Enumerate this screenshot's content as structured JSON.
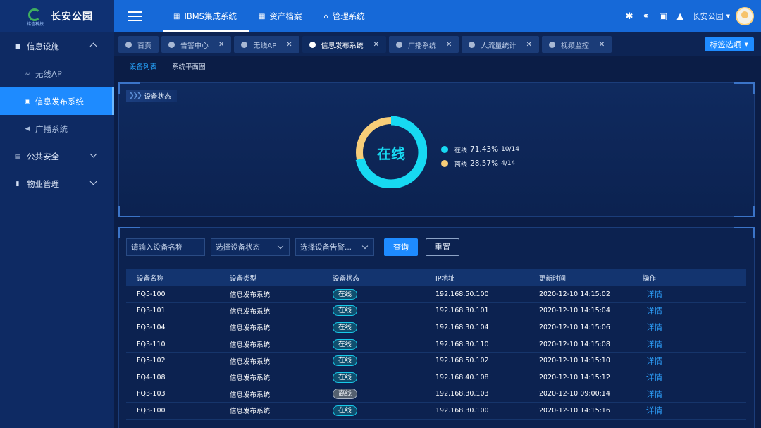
{
  "sidebar": {
    "logo_text": "长安公园",
    "logo_small": "铭信科技",
    "groups": [
      {
        "label": "信息设施",
        "icon": "chat-icon",
        "expanded": true,
        "items": [
          {
            "label": "无线AP",
            "icon": "wifi-icon",
            "active": false
          },
          {
            "label": "信息发布系统",
            "icon": "bus-icon",
            "active": true
          },
          {
            "label": "广播系统",
            "icon": "speaker-icon",
            "active": false
          }
        ]
      },
      {
        "label": "公共安全",
        "icon": "bed-icon",
        "expanded": false
      },
      {
        "label": "物业管理",
        "icon": "map-icon",
        "expanded": false
      }
    ]
  },
  "topbar": {
    "menus": [
      {
        "label": "IBMS集成系统",
        "icon": "grid-icon",
        "active": true
      },
      {
        "label": "资产档案",
        "icon": "grid-icon",
        "active": false
      },
      {
        "label": "管理系统",
        "icon": "home-icon",
        "active": false
      }
    ],
    "user": "长安公园",
    "icons": [
      "fullscreen-icon",
      "globe-icon",
      "lock-icon",
      "bell-icon"
    ]
  },
  "tabs": [
    {
      "label": "首页",
      "closable": false,
      "active": false
    },
    {
      "label": "告警中心",
      "closable": true,
      "active": false
    },
    {
      "label": "无线AP",
      "closable": true,
      "active": false
    },
    {
      "label": "信息发布系统",
      "closable": true,
      "active": true
    },
    {
      "label": "广播系统",
      "closable": true,
      "active": false
    },
    {
      "label": "人流量统计",
      "closable": true,
      "active": false
    },
    {
      "label": "视频监控",
      "closable": true,
      "active": false
    }
  ],
  "tag_options_label": "标签选项",
  "subtabs": [
    {
      "label": "设备列表",
      "active": true
    },
    {
      "label": "系统平面图",
      "active": false
    }
  ],
  "status_panel": {
    "title": "设备状态",
    "center_label": "在线",
    "colors": {
      "online": "#17d9f2",
      "offline": "#f7cd78"
    },
    "legend": [
      {
        "label": "在线",
        "percent": "71.43%",
        "ratio": "10/14",
        "value": 10
      },
      {
        "label": "离线",
        "percent": "28.57%",
        "ratio": "4/14",
        "value": 4
      }
    ]
  },
  "filters": {
    "name_placeholder": "请输入设备名称",
    "status_placeholder": "选择设备状态",
    "alarm_placeholder": "选择设备告警...",
    "query_label": "查询",
    "reset_label": "重置"
  },
  "table": {
    "headers": [
      "设备名称",
      "设备类型",
      "设备状态",
      "IP地址",
      "更新时间",
      "操作"
    ],
    "detail_label": "详情",
    "rows": [
      {
        "name": "FQ5-100",
        "type": "信息发布系统",
        "status": "在线",
        "online": true,
        "ip": "192.168.50.100",
        "time": "2020-12-10 14:15:02"
      },
      {
        "name": "FQ3-101",
        "type": "信息发布系统",
        "status": "在线",
        "online": true,
        "ip": "192.168.30.101",
        "time": "2020-12-10 14:15:04"
      },
      {
        "name": "FQ3-104",
        "type": "信息发布系统",
        "status": "在线",
        "online": true,
        "ip": "192.168.30.104",
        "time": "2020-12-10 14:15:06"
      },
      {
        "name": "FQ3-110",
        "type": "信息发布系统",
        "status": "在线",
        "online": true,
        "ip": "192.168.30.110",
        "time": "2020-12-10 14:15:08"
      },
      {
        "name": "FQ5-102",
        "type": "信息发布系统",
        "status": "在线",
        "online": true,
        "ip": "192.168.50.102",
        "time": "2020-12-10 14:15:10"
      },
      {
        "name": "FQ4-108",
        "type": "信息发布系统",
        "status": "在线",
        "online": true,
        "ip": "192.168.40.108",
        "time": "2020-12-10 14:15:12"
      },
      {
        "name": "FQ3-103",
        "type": "信息发布系统",
        "status": "离线",
        "online": false,
        "ip": "192.168.30.103",
        "time": "2020-12-10 09:00:14"
      },
      {
        "name": "FQ3-100",
        "type": "信息发布系统",
        "status": "在线",
        "online": true,
        "ip": "192.168.30.100",
        "time": "2020-12-10 14:15:16"
      }
    ]
  }
}
